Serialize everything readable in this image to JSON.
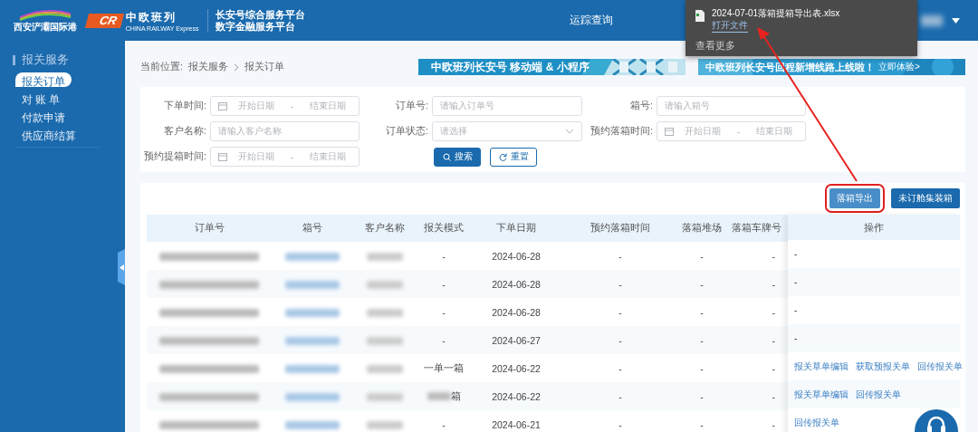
{
  "header": {
    "port_logo": "西安浐灞国际港",
    "cr_mark": "CR",
    "cr_name": "中欧班列",
    "cr_sub": "CHINA RAILWAY Express",
    "titles": [
      "长安号综合服务平台",
      "数字金融服务平台"
    ],
    "nav": "运踪查询"
  },
  "download_popup": {
    "file": "2024-07-01落箱提箱导出表.xlsx",
    "open": "打开文件",
    "more": "查看更多"
  },
  "sidebar": {
    "group": "报关服务",
    "items": [
      {
        "label": "报关订单",
        "selected": true
      },
      {
        "label": "对 账 单",
        "selected": false
      },
      {
        "label": "付款申请",
        "selected": false
      },
      {
        "label": "供应商结算",
        "selected": false
      }
    ]
  },
  "breadcrumb": {
    "prefix": "当前位置:",
    "items": [
      "报关服务",
      "报关订单"
    ]
  },
  "banners": [
    {
      "text": "中欧班列长安号 移动端 & 小程序"
    },
    {
      "text": "中欧班列长安号回程新增线路上线啦！",
      "cta": "立即体验>"
    }
  ],
  "filters": [
    {
      "label": "下单时间:",
      "kind": "date",
      "start": "开始日期",
      "sep": "-",
      "end": "结束日期"
    },
    {
      "label": "订单号:",
      "kind": "text",
      "placeholder": "请输入订单号"
    },
    {
      "label": "箱号:",
      "kind": "text",
      "placeholder": "请输入箱号"
    },
    {
      "label": "客户名称:",
      "kind": "text",
      "placeholder": "请输入客户名称"
    },
    {
      "label": "订单状态:",
      "kind": "select",
      "placeholder": "请选择"
    },
    {
      "label": "预约落箱时间:",
      "kind": "date",
      "start": "开始日期",
      "sep": "-",
      "end": "结束日期"
    },
    {
      "label": "预约提箱时间:",
      "kind": "date",
      "start": "开始日期",
      "sep": "-",
      "end": "结束日期"
    }
  ],
  "filter_buttons": [
    {
      "label": "搜索",
      "kind": "primary"
    },
    {
      "label": "重置",
      "kind": "outline"
    }
  ],
  "table_buttons": [
    {
      "label": "落箱导出",
      "highlighted": true
    },
    {
      "label": "未订舱集装箱",
      "highlighted": false
    }
  ],
  "table": {
    "columns": [
      "订单号",
      "箱号",
      "客户名称",
      "报关模式",
      "下单日期",
      "预约落箱时间",
      "落箱堆场",
      "落箱车牌号",
      "操作"
    ],
    "rows": [
      {
        "mode": "-",
        "date": "2024-06-28",
        "slot": "-",
        "yard": "-",
        "plate": "-",
        "actions": [
          {
            "label": "-",
            "kind": "text"
          }
        ]
      },
      {
        "mode": "-",
        "date": "2024-06-28",
        "slot": "-",
        "yard": "-",
        "plate": "-",
        "actions": [
          {
            "label": "-",
            "kind": "text"
          }
        ]
      },
      {
        "mode": "-",
        "date": "2024-06-28",
        "slot": "-",
        "yard": "-",
        "plate": "-",
        "actions": [
          {
            "label": "-",
            "kind": "text"
          }
        ]
      },
      {
        "mode": "-",
        "date": "2024-06-27",
        "slot": "-",
        "yard": "-",
        "plate": "-",
        "actions": [
          {
            "label": "-",
            "kind": "text"
          }
        ]
      },
      {
        "mode": "一单一箱",
        "date": "2024-06-22",
        "slot": "-",
        "yard": "-",
        "plate": "-",
        "actions": [
          {
            "label": "报关草单编辑",
            "kind": "link"
          },
          {
            "label": "获取预报关单",
            "kind": "link"
          },
          {
            "label": "回传报关单",
            "kind": "link"
          }
        ]
      },
      {
        "mode": "箱",
        "mode_redacted": true,
        "date": "2024-06-22",
        "slot": "-",
        "yard": "-",
        "plate": "-",
        "actions": [
          {
            "label": "报关草单编辑",
            "kind": "link"
          },
          {
            "label": "回传报关单",
            "kind": "link"
          }
        ]
      },
      {
        "mode": "-",
        "date": "2024-06-21",
        "slot": "-",
        "yard": "-",
        "plate": "-",
        "actions": [
          {
            "label": "回传报关单",
            "kind": "link"
          }
        ]
      }
    ]
  }
}
